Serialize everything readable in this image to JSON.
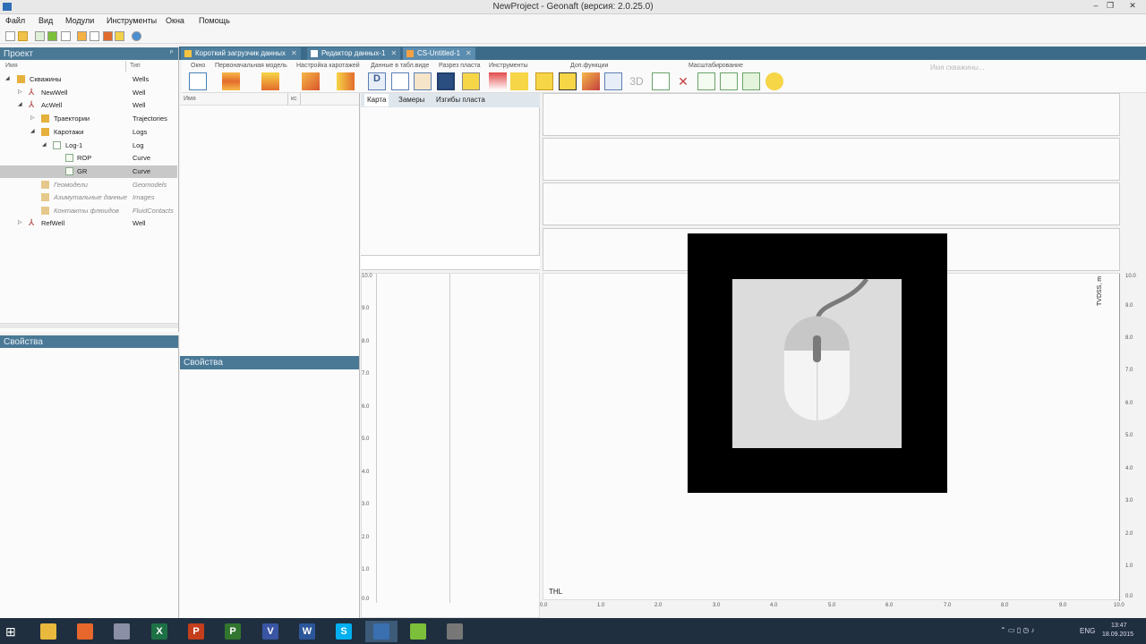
{
  "window": {
    "title": "NewProject - Geonaft (версия: 2.0.25.0)"
  },
  "menu": [
    "Файл",
    "Вид",
    "Модули",
    "Инструменты",
    "Окна",
    "Помощь"
  ],
  "tabs": [
    {
      "label": "Короткий загрузчик данных",
      "close": "✕"
    },
    {
      "label": "Редактор данных-1",
      "close": "✕"
    },
    {
      "label": "CS-Untitled-1",
      "close": "✕"
    }
  ],
  "ribbon": {
    "groups": [
      "Окно",
      "Первоначальная модель",
      "Настройка каротажей",
      "Данные в табл.виде",
      "Разрез пласта",
      "Инструменты",
      "Доп.функции",
      "Масштабирование"
    ],
    "placeholder": "Имя скважины...",
    "label_3d": "3D"
  },
  "project": {
    "header": "Проект",
    "pin": "ᵖ",
    "col_name": "Имя",
    "col_type": "Тип",
    "rows": [
      {
        "label": "Скважины",
        "type": "Wells"
      },
      {
        "label": "NewWell",
        "type": "Well"
      },
      {
        "label": "AcWell",
        "type": "Well"
      },
      {
        "label": "Траектории",
        "type": "Trajectories"
      },
      {
        "label": "Каротажи",
        "type": "Logs"
      },
      {
        "label": "Log-1",
        "type": "Log"
      },
      {
        "label": "ROP",
        "type": "Curve"
      },
      {
        "label": "GR",
        "type": "Curve"
      },
      {
        "label": "Геомодели",
        "type": "Geomodels"
      },
      {
        "label": "Азимутальные данные",
        "type": "Images"
      },
      {
        "label": "Контакты флюидов",
        "type": "FluidContacts"
      },
      {
        "label": "RefWell",
        "type": "Well"
      }
    ]
  },
  "properties": {
    "header": "Свойства"
  },
  "middle": {
    "col_name": "Имя",
    "col_short": "кс",
    "prop_header": "Свойства"
  },
  "subtabs": [
    "Карта",
    "Замеры",
    "Изгибы пласта"
  ],
  "plot": {
    "y_left_ticks": [
      "10.0",
      "9.0",
      "8.0",
      "7.0",
      "6.0",
      "5.0",
      "4.0",
      "3.0",
      "2.0",
      "1.0",
      "0.0"
    ],
    "y_right_ticks": [
      "10.0",
      "9.0",
      "8.0",
      "7.0",
      "6.0",
      "5.0",
      "4.0",
      "3.0",
      "2.0",
      "1.0",
      "0.0"
    ],
    "x_ticks": [
      "0.0",
      "1.0",
      "2.0",
      "3.0",
      "4.0",
      "5.0",
      "6.0",
      "7.0",
      "8.0",
      "9.0",
      "10.0"
    ],
    "x_label": "THL",
    "y_label": "TVDSS, m"
  },
  "taskbar": {
    "apps": [
      {
        "icon": "explorer-icon",
        "glyph": "",
        "color": "#e8b93c"
      },
      {
        "icon": "firefox-icon",
        "glyph": "",
        "color": "#e8672c"
      },
      {
        "icon": "tool-icon",
        "glyph": "",
        "color": "#8a8fa5"
      },
      {
        "icon": "excel-icon",
        "glyph": "X",
        "color": "#1e7145"
      },
      {
        "icon": "powerpoint-icon",
        "glyph": "P",
        "color": "#c43e1c"
      },
      {
        "icon": "project-icon",
        "glyph": "P",
        "color": "#31752f"
      },
      {
        "icon": "visio-icon",
        "glyph": "V",
        "color": "#3955a3"
      },
      {
        "icon": "word-icon",
        "glyph": "W",
        "color": "#2b579a"
      },
      {
        "icon": "skype-icon",
        "glyph": "S",
        "color": "#00aff0"
      },
      {
        "icon": "geonaft-icon",
        "glyph": "",
        "color": "#3a6fb0"
      },
      {
        "icon": "leaf-icon",
        "glyph": "",
        "color": "#7cbf3a"
      },
      {
        "icon": "grid-app-icon",
        "glyph": "",
        "color": "#777"
      }
    ],
    "lang": "ENG",
    "time": "13:47",
    "date": "18.09.2015"
  },
  "colors": {
    "panel_header": "#4a7996",
    "tab_bar": "#3c6b8a",
    "selection": "#c8c8c8"
  }
}
